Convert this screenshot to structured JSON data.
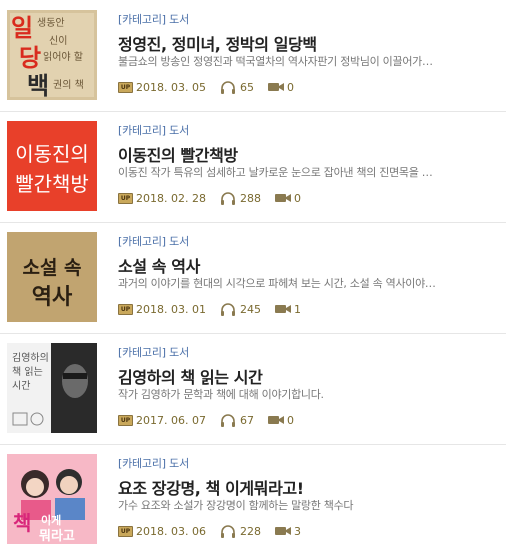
{
  "items": [
    {
      "category": "[카테고리] 도서",
      "title": "정영진, 정미녀, 정박의 일당백",
      "description": "불금쇼의 방송인 정영진과 떡국열차의 역사자판기 정박님이 이끌어가…",
      "up_label": "UP",
      "date": "2018. 03. 05",
      "listens": "65",
      "comments": "0",
      "thumb": {
        "chars": [
          "일",
          "당",
          "백"
        ],
        "subtitle": "생동안 신이 읽어야 할 권의 책"
      }
    },
    {
      "category": "[카테고리] 도서",
      "title": "이동진의 빨간책방",
      "description": "이동진 작가 특유의 섬세하고 날카로운 눈으로 잡아낸 책의 진면목을 …",
      "up_label": "UP",
      "date": "2018. 02. 28",
      "listens": "288",
      "comments": "0",
      "thumb": {
        "line1": "이동진의",
        "line2": "빨간책방"
      }
    },
    {
      "category": "[카테고리] 도서",
      "title": "소설 속 역사",
      "description": "과거의 이야기를 현대의 시각으로 파헤쳐 보는 시간, 소설 속 역사이야…",
      "up_label": "UP",
      "date": "2018. 03. 01",
      "listens": "245",
      "comments": "1",
      "thumb": {
        "line1": "소설 속",
        "line2": "역사"
      }
    },
    {
      "category": "[카테고리] 도서",
      "title": "김영하의 책 읽는 시간",
      "description": "작가 김영하가 문학과 책에 대해 이야기합니다.",
      "up_label": "UP",
      "date": "2017. 06. 07",
      "listens": "67",
      "comments": "0",
      "thumb": {
        "line1": "김영하의",
        "line2": "책 읽는",
        "line3": "시간"
      }
    },
    {
      "category": "[카테고리] 도서",
      "title": "요조 장강명, 책 이게뭐라고!",
      "description": "가수 요조와 소설가 장강명이 함께하는 말랑한 책수다",
      "up_label": "UP",
      "date": "2018. 03. 06",
      "listens": "228",
      "comments": "3",
      "thumb": {
        "chars": [
          "책",
          "이게",
          "뭐라고"
        ]
      }
    }
  ],
  "colors": {
    "category": "#4a6fa8",
    "title": "#222222",
    "description": "#777777",
    "meta": "#7a6a30",
    "up_badge": "#c9a85b",
    "thumb_red": "#e8402a",
    "thumb_kraft": "#c7ab78",
    "thumb_pink": "#f7b8c6"
  },
  "icons": {
    "up": "up-badge-icon",
    "listens": "headphones-icon",
    "comments": "comment-camera-icon"
  }
}
